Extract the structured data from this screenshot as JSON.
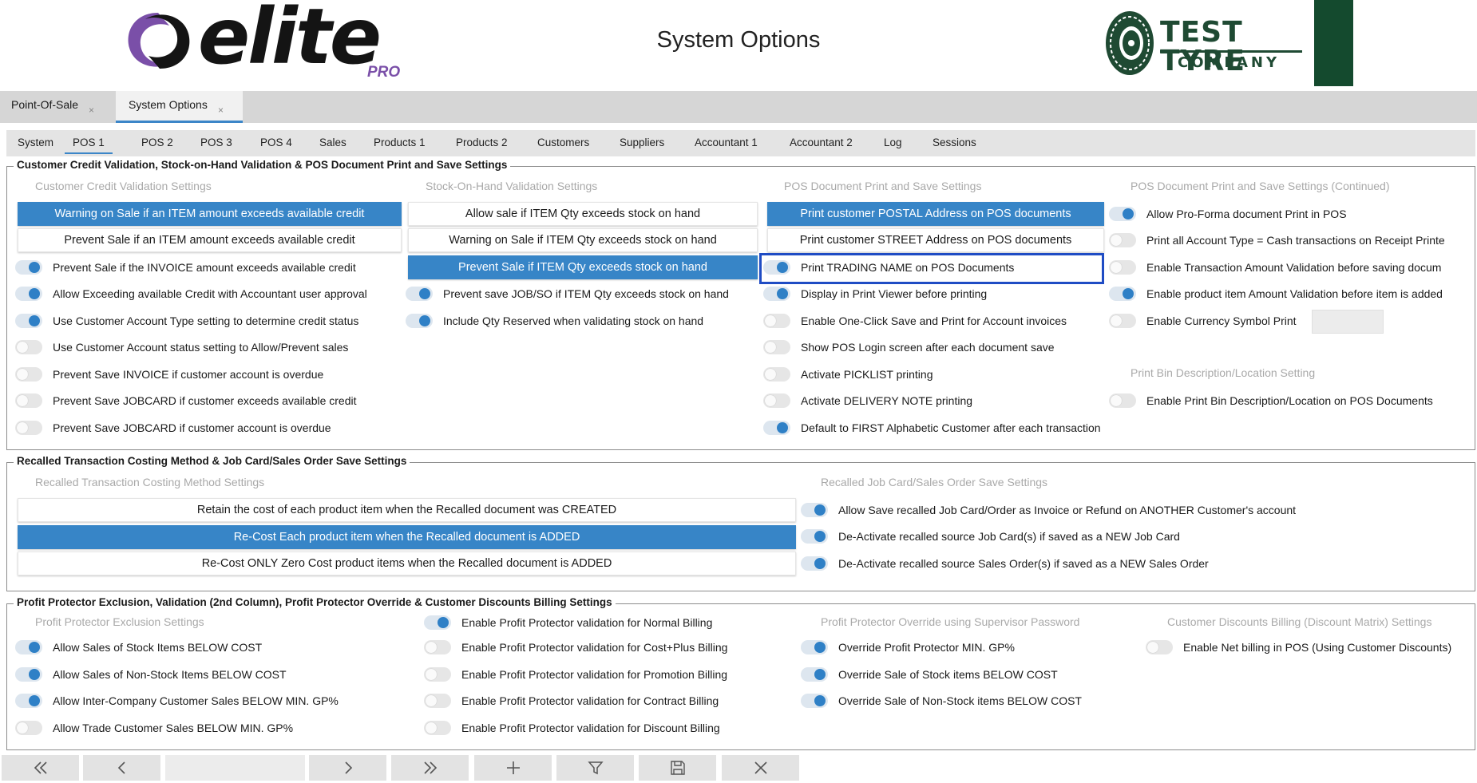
{
  "header": {
    "title": "System Options",
    "brand_logo": "elite",
    "brand_sub": "PRO",
    "company_line1": "TEST TYRE",
    "company_line2": "COMPANY",
    "company_color": "#1f4a33",
    "accent_color": "#7a4fa8"
  },
  "doc_tabs": [
    {
      "label": "Point-Of-Sale",
      "close": "×"
    },
    {
      "label": "System Options",
      "close": "×"
    }
  ],
  "setting_tabs": [
    "System",
    "POS 1",
    "POS 2",
    "POS 3",
    "POS 4",
    "Sales",
    "Products 1",
    "Products 2",
    "Customers",
    "Suppliers",
    "Accountant 1",
    "Accountant 2",
    "Log",
    "Sessions"
  ],
  "active_setting_tab": "POS 1",
  "group1": {
    "title": "Customer Credit Validation, Stock-on-Hand Validation & POS Document Print and Save Settings",
    "col1": {
      "header": "Customer Credit Validation Settings",
      "buttons": [
        {
          "label": "Warning on Sale if an ITEM amount exceeds available credit",
          "selected": true
        },
        {
          "label": "Prevent Sale if an ITEM amount exceeds available credit",
          "selected": false
        }
      ],
      "options": [
        {
          "label": "Prevent Sale if the INVOICE amount exceeds available credit",
          "on": true
        },
        {
          "label": "Allow Exceeding available Credit with Accountant user approval",
          "on": true
        },
        {
          "label": "Use Customer Account Type setting to determine credit status",
          "on": true
        },
        {
          "label": "Use Customer Account status setting to Allow/Prevent sales",
          "on": false
        },
        {
          "label": "Prevent Save INVOICE if customer account is overdue",
          "on": false
        },
        {
          "label": "Prevent Save JOBCARD if customer exceeds available credit",
          "on": false
        },
        {
          "label": "Prevent Save JOBCARD if customer account is overdue",
          "on": false
        }
      ]
    },
    "col2": {
      "header": "Stock-On-Hand Validation Settings",
      "buttons": [
        {
          "label": "Allow sale if ITEM Qty exceeds stock on hand",
          "selected": false
        },
        {
          "label": "Warning on Sale if ITEM Qty exceeds stock on hand",
          "selected": false
        },
        {
          "label": "Prevent Sale if ITEM Qty exceeds stock on hand",
          "selected": true
        }
      ],
      "options": [
        {
          "label": "Prevent save JOB/SO if ITEM Qty exceeds stock on hand",
          "on": true
        },
        {
          "label": "Include Qty Reserved when validating stock on hand",
          "on": true
        }
      ]
    },
    "col3": {
      "header": "POS Document Print and Save Settings",
      "buttons": [
        {
          "label": "Print customer POSTAL Address on POS documents",
          "selected": true
        },
        {
          "label": "Print customer STREET Address on POS documents",
          "selected": false
        }
      ],
      "options": [
        {
          "label": "Print TRADING NAME on POS Documents",
          "on": true
        },
        {
          "label": "Display in Print Viewer before printing",
          "on": true
        },
        {
          "label": "Enable One-Click Save and Print for Account invoices",
          "on": false
        },
        {
          "label": "Show POS Login screen after each document save",
          "on": false
        },
        {
          "label": "Activate PICKLIST printing",
          "on": false
        },
        {
          "label": "Activate DELIVERY NOTE printing",
          "on": false
        },
        {
          "label": "Default to FIRST Alphabetic Customer after each transaction",
          "on": true
        }
      ]
    },
    "col4": {
      "header": "POS Document Print and Save Settings (Continued)",
      "options": [
        {
          "label": "Allow Pro-Forma document Print in POS",
          "on": true
        },
        {
          "label": "Print all Account Type = Cash transactions on Receipt Printe",
          "on": false
        },
        {
          "label": "Enable Transaction Amount Validation before saving docum",
          "on": false
        },
        {
          "label": "Enable product item Amount Validation before item is added",
          "on": true
        },
        {
          "label": "Enable Currency Symbol Print",
          "on": false
        }
      ],
      "bin_header": "Print Bin Description/Location Setting",
      "bin_option": {
        "label": "Enable Print Bin Description/Location on POS Documents",
        "on": false
      }
    }
  },
  "group2": {
    "title": "Recalled Transaction Costing Method & Job Card/Sales Order Save Settings",
    "left_header": "Recalled Transaction Costing Method Settings",
    "buttons": [
      {
        "label": "Retain the cost of each product item when the Recalled document was CREATED",
        "selected": false
      },
      {
        "label": "Re-Cost Each product item when the Recalled document is ADDED",
        "selected": true
      },
      {
        "label": "Re-Cost ONLY Zero Cost product items when the Recalled document is ADDED",
        "selected": false
      }
    ],
    "right_header": "Recalled Job Card/Sales Order Save Settings",
    "options": [
      {
        "label": "Allow Save recalled Job Card/Order as Invoice or Refund on ANOTHER Customer's account",
        "on": true
      },
      {
        "label": "De-Activate recalled source Job Card(s) if saved as a NEW Job Card",
        "on": true
      },
      {
        "label": "De-Activate recalled source Sales Order(s) if saved as a NEW Sales Order",
        "on": true
      }
    ]
  },
  "group3": {
    "title": "Profit Protector Exclusion, Validation (2nd Column), Profit Protector Override & Customer Discounts Billing Settings",
    "col1": {
      "header": "Profit Protector Exclusion Settings",
      "options": [
        {
          "label": "Allow Sales of Stock Items BELOW COST",
          "on": true
        },
        {
          "label": "Allow Sales of Non-Stock Items BELOW COST",
          "on": true
        },
        {
          "label": "Allow Inter-Company Customer Sales BELOW MIN. GP%",
          "on": true
        },
        {
          "label": "Allow Trade Customer Sales BELOW MIN. GP%",
          "on": false
        }
      ]
    },
    "col2": {
      "options": [
        {
          "label": "Enable Profit Protector validation for Normal Billing",
          "on": true
        },
        {
          "label": "Enable Profit Protector validation for Cost+Plus Billing",
          "on": false
        },
        {
          "label": "Enable Profit Protector validation for Promotion Billing",
          "on": false
        },
        {
          "label": "Enable Profit Protector validation for Contract Billing",
          "on": false
        },
        {
          "label": "Enable Profit Protector validation for Discount Billing",
          "on": false
        }
      ]
    },
    "col3": {
      "header": "Profit Protector Override using Supervisor Password",
      "options": [
        {
          "label": "Override Profit Protector MIN. GP%",
          "on": true
        },
        {
          "label": "Override Sale of Stock items BELOW COST",
          "on": true
        },
        {
          "label": "Override Sale of Non-Stock items BELOW COST",
          "on": true
        }
      ]
    },
    "col4": {
      "header": "Customer Discounts Billing (Discount Matrix) Settings",
      "options": [
        {
          "label": "Enable Net billing in POS (Using Customer Discounts)",
          "on": false
        }
      ]
    }
  },
  "navbar": {
    "icons": [
      "first-icon",
      "previous-icon",
      "next-icon",
      "last-icon",
      "add-icon",
      "filter-icon",
      "save-icon",
      "close-icon"
    ],
    "record_field": ""
  }
}
